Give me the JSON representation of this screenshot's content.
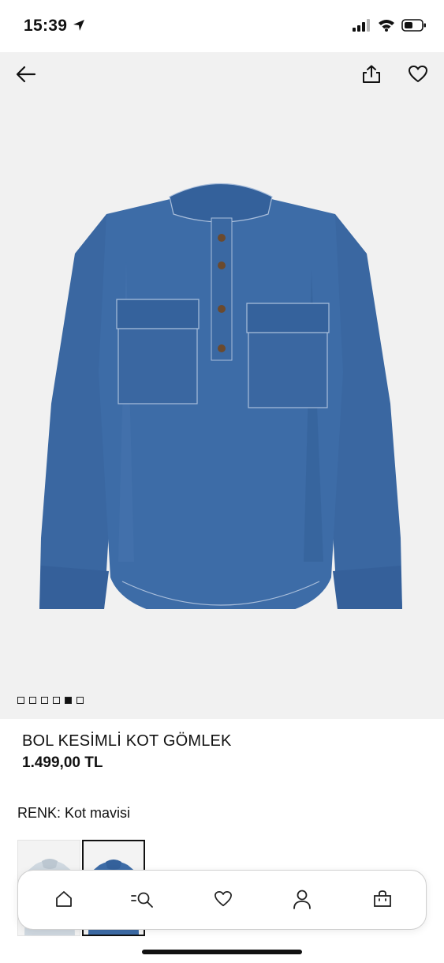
{
  "status_bar": {
    "time": "15:39"
  },
  "product": {
    "title": "BOL KESİMLİ KOT GÖMLEK",
    "price": "1.499,00 TL",
    "color_label": "RENK: Kot mavisi",
    "image_count": 6,
    "active_image_index": 4
  },
  "header_actions": {
    "back_icon": "arrow-left-icon",
    "share_icon": "share-icon",
    "favorite_icon": "heart-icon"
  },
  "bottom_nav": {
    "items": [
      {
        "icon": "home-icon"
      },
      {
        "icon": "search-filter-icon"
      },
      {
        "icon": "heart-icon"
      },
      {
        "icon": "user-icon"
      },
      {
        "icon": "shopping-bag-icon"
      }
    ]
  },
  "colors": {
    "hero_background": "#f1f1f1",
    "denim": "#3b6aa5",
    "text": "#111111"
  }
}
